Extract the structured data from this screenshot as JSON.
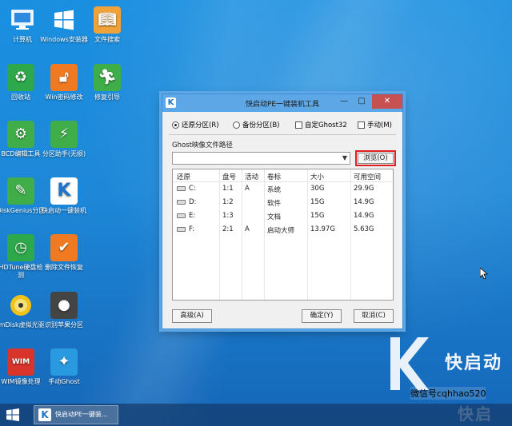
{
  "desktop": {
    "icons": [
      {
        "label": "计算机",
        "icon": "computer-icon"
      },
      {
        "label": "Windows安装器",
        "icon": "windows-installer-icon"
      },
      {
        "label": "文件搜索",
        "icon": "file-search-icon"
      },
      {
        "label": "回收站",
        "icon": "recycle-bin-icon"
      },
      {
        "label": "Win密码修改",
        "icon": "password-icon"
      },
      {
        "label": "修复引导",
        "icon": "boot-repair-icon"
      },
      {
        "label": "BCD编辑工具",
        "icon": "bcd-gear-icon"
      },
      {
        "label": "分区助手(无损)",
        "icon": "partition-assistant-icon"
      },
      {
        "label": "DiskGenius分区",
        "icon": "diskgenius-icon"
      },
      {
        "label": "快启动一键装机",
        "icon": "kqd-installer-icon"
      },
      {
        "label": "HDTune硬盘检测",
        "icon": "hdtune-icon"
      },
      {
        "label": "删除文件恢复",
        "icon": "file-restore-icon"
      },
      {
        "label": "ImDisk虚拟光驱",
        "icon": "imdisk-icon"
      },
      {
        "label": "识别苹果分区",
        "icon": "apple-partition-icon"
      },
      {
        "label": "WIM镜像处理",
        "icon": "wim-icon"
      },
      {
        "label": "手动Ghost",
        "icon": "ghost-icon"
      }
    ]
  },
  "dialog": {
    "title": "快启动PE一键装机工具",
    "window_controls": {
      "min": "—",
      "max": "□",
      "close": "✕"
    },
    "options": {
      "restore": "还原分区(R)",
      "backup": "备份分区(B)",
      "auto_ghost32": "自定Ghost32",
      "manual": "手动(M)"
    },
    "selected_option": "restore",
    "path_label": "Ghost映像文件路径",
    "path_value": "",
    "browse_label": "浏览(O)",
    "table": {
      "columns": [
        "还原",
        "盘号",
        "活动",
        "卷标",
        "大小",
        "可用空间"
      ],
      "rows": [
        {
          "drive": "C:",
          "num": "1:1",
          "active": "A",
          "label": "系统",
          "size": "30G",
          "free": "29.9G"
        },
        {
          "drive": "D:",
          "num": "1:2",
          "active": "",
          "label": "软件",
          "size": "15G",
          "free": "14.9G"
        },
        {
          "drive": "E:",
          "num": "1:3",
          "active": "",
          "label": "文档",
          "size": "15G",
          "free": "14.9G"
        },
        {
          "drive": "F:",
          "num": "2:1",
          "active": "A",
          "label": "启动大师",
          "size": "13.97G",
          "free": "5.63G"
        }
      ]
    },
    "buttons": {
      "advanced": "高级(A)",
      "ok": "确定(Y)",
      "cancel": "取消(C)"
    }
  },
  "brand": {
    "text": "快启动",
    "watermark": "微信号cqhhao520",
    "text2": "快启"
  },
  "taskbar": {
    "task_label": "快启动PE一键装..."
  },
  "colors": {
    "accent": "#5ea7e6",
    "browse_highlight": "#e02020",
    "close": "#c75050"
  }
}
